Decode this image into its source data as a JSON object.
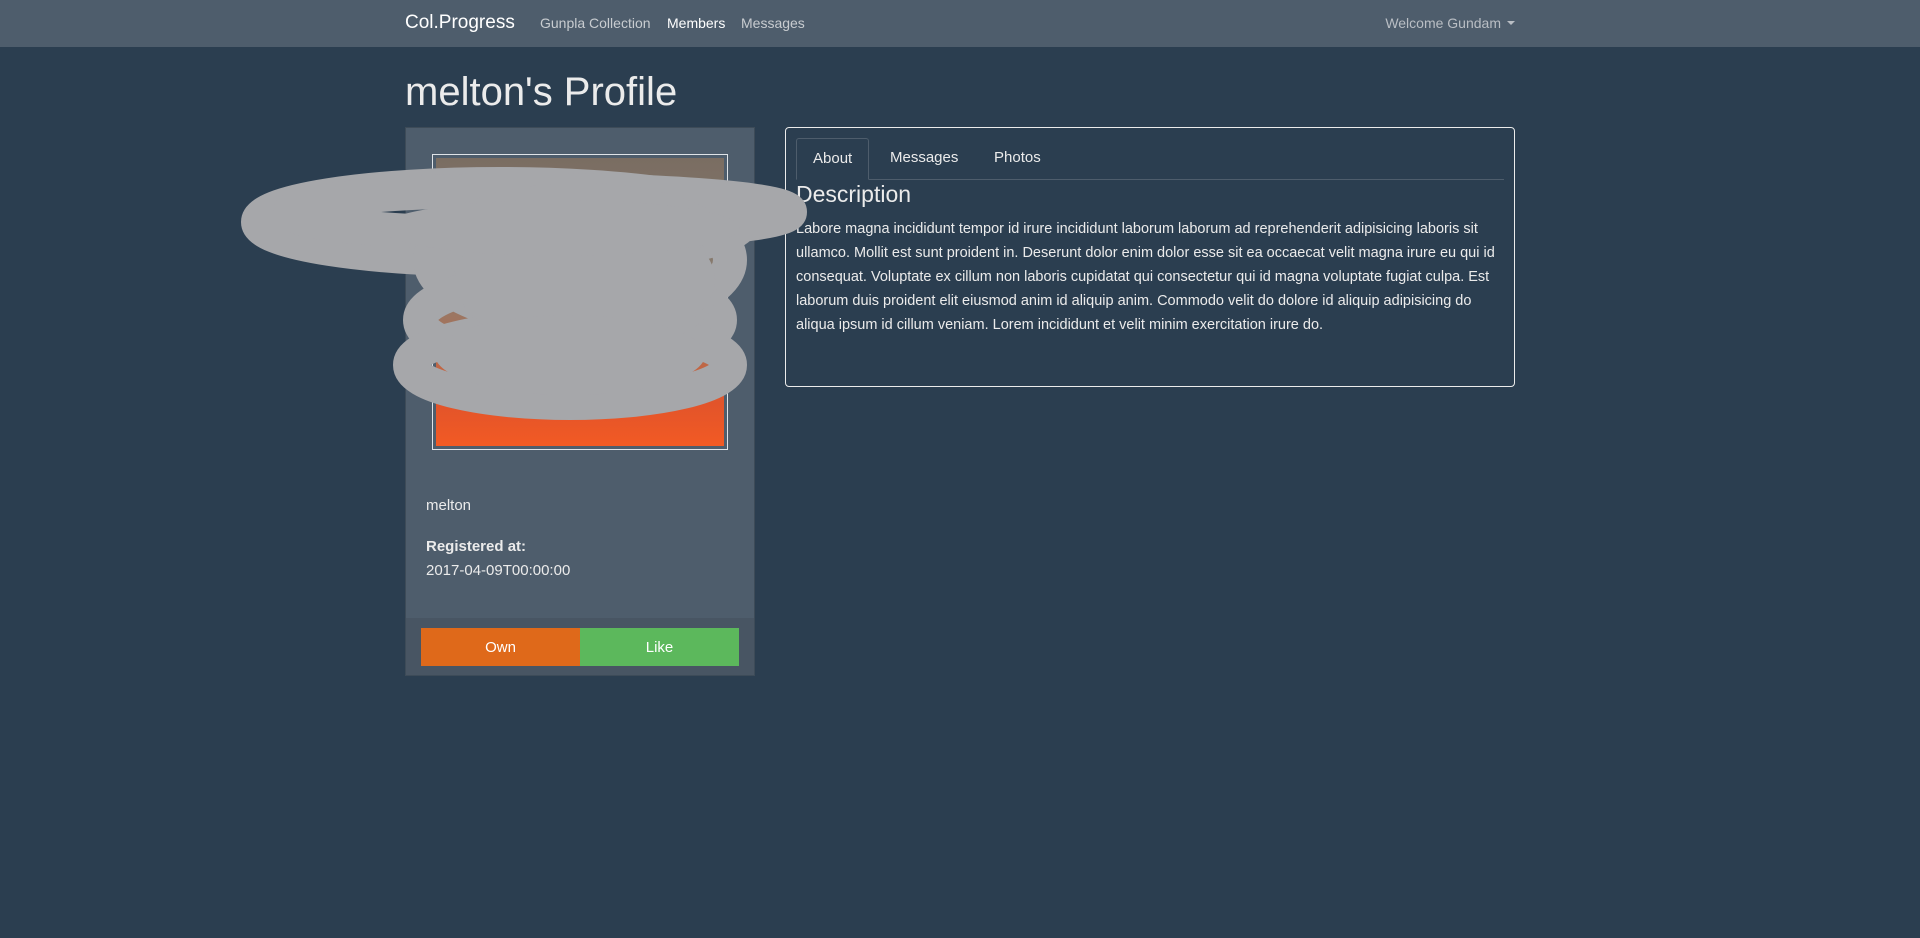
{
  "navbar": {
    "brand": "Col.Progress",
    "links": [
      "Gunpla Collection",
      "Members",
      "Messages"
    ],
    "welcome": "Welcome Gundam"
  },
  "page": {
    "title": "melton's Profile"
  },
  "profile": {
    "username": "melton",
    "registered_label": "Registered at:",
    "registered_value": "2017-04-09T00:00:00",
    "own_button": "Own",
    "like_button": "Like"
  },
  "tabs": [
    "About",
    "Messages",
    "Photos"
  ],
  "about": {
    "heading": "Description",
    "text": "Labore magna incididunt tempor id irure incididunt laborum laborum ad reprehenderit adipisicing laboris sit ullamco. Mollit est sunt proident in. Deserunt dolor enim dolor esse sit ea occaecat velit magna irure eu qui id consequat. Voluptate ex cillum non laboris cupidatat qui consectetur qui id magna voluptate fugiat culpa. Est laborum duis proident elit eiusmod anim id aliquip anim. Commodo velit do dolore id aliquip adipisicing do aliqua ipsum id cillum veniam. Lorem incididunt et velit minim exercitation irure do."
  },
  "colors": {
    "background": "#2b3e50",
    "navbar": "#4e5d6c",
    "own": "#df691a",
    "like": "#5cb85c"
  }
}
